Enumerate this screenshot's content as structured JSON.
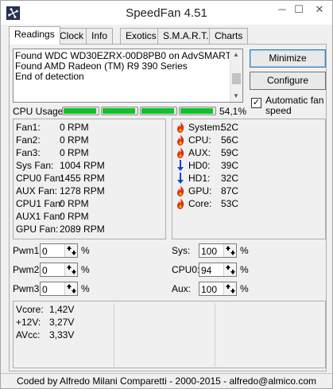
{
  "window": {
    "title": "SpeedFan 4.51",
    "controls": {
      "minimize": "─",
      "maximize": "☐",
      "close": "✕"
    }
  },
  "tabs": [
    {
      "label": "Readings",
      "active": true
    },
    {
      "label": "Clock"
    },
    {
      "label": "Info"
    },
    {
      "label": "Exotics"
    },
    {
      "label": "S.M.A.R.T."
    },
    {
      "label": "Charts"
    }
  ],
  "log": {
    "lines": [
      "Found WDC WD30EZRX-00D8PB0 on AdvSMART",
      "Found AMD Radeon (TM) R9 390 Series",
      "End of detection"
    ]
  },
  "buttons": {
    "minimize": "Minimize",
    "configure": "Configure"
  },
  "auto_fan": {
    "label": "Automatic fan speed",
    "checked": true,
    "check_glyph": "✓"
  },
  "cpu_usage": {
    "label": "CPU Usage",
    "percent": "54,1%",
    "cores": [
      0.95,
      0.95,
      0.95,
      0.95
    ]
  },
  "fans": [
    {
      "label": "Fan1:",
      "value": "0 RPM"
    },
    {
      "label": "Fan2:",
      "value": "0 RPM"
    },
    {
      "label": "Fan3:",
      "value": "0 RPM"
    },
    {
      "label": "Sys Fan:",
      "value": "1004 RPM"
    },
    {
      "label": "CPU0 Fan:",
      "value": "1455 RPM"
    },
    {
      "label": "AUX Fan:",
      "value": "1278 RPM"
    },
    {
      "label": "CPU1 Fan:",
      "value": "0 RPM"
    },
    {
      "label": "AUX1 Fan:",
      "value": "0 RPM"
    },
    {
      "label": "GPU Fan:",
      "value": "2089 RPM"
    }
  ],
  "temps": [
    {
      "label": "System:",
      "value": "52C",
      "icon": "flame-icon"
    },
    {
      "label": "CPU:",
      "value": "56C",
      "icon": "flame-icon"
    },
    {
      "label": "AUX:",
      "value": "59C",
      "icon": "flame-icon"
    },
    {
      "label": "HD0:",
      "value": "39C",
      "icon": "down-arrow-icon"
    },
    {
      "label": "HD1:",
      "value": "32C",
      "icon": "down-arrow-icon"
    },
    {
      "label": "GPU:",
      "value": "87C",
      "icon": "flame-icon"
    },
    {
      "label": "Core:",
      "value": "53C",
      "icon": "flame-icon"
    }
  ],
  "pwm": [
    {
      "label": "Pwm1:",
      "value": "0",
      "unit": "%"
    },
    {
      "label": "Pwm2:",
      "value": "0",
      "unit": "%"
    },
    {
      "label": "Pwm3:",
      "value": "0",
      "unit": "%"
    }
  ],
  "speeds": [
    {
      "label": "Sys:",
      "value": "100",
      "unit": "%"
    },
    {
      "label": "CPU0:",
      "value": "94",
      "unit": "%"
    },
    {
      "label": "Aux:",
      "value": "100",
      "unit": "%"
    }
  ],
  "voltages": [
    {
      "label": "Vcore:",
      "value": "1,42V"
    },
    {
      "label": "+12V:",
      "value": "3,27V"
    },
    {
      "label": "AVcc:",
      "value": "3,33V"
    }
  ],
  "status_bar": "Coded by Alfredo Milani Comparetti - 2000-2015 - alfredo@almico.com",
  "colors": {
    "bar_green": "#12c12b",
    "flame_red": "#e03010",
    "arrow_blue": "#1a3fd0"
  }
}
